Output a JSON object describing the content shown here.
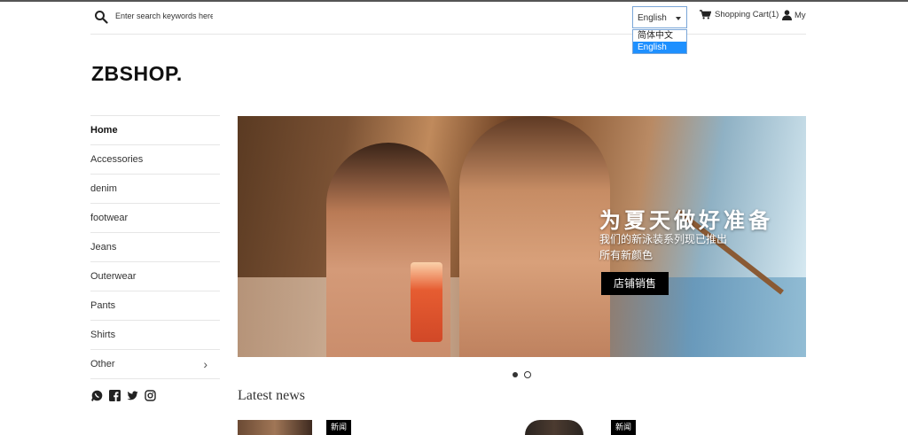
{
  "header": {
    "search_placeholder": "Enter search keywords here",
    "language": {
      "selected": "English",
      "options": [
        "简体中文",
        "English"
      ],
      "highlighted_index": 1
    },
    "cart_label": "Shopping Cart(1)",
    "account_label": "My"
  },
  "logo": "ZBSHOP.",
  "sidebar": {
    "items": [
      {
        "label": "Home"
      },
      {
        "label": "Accessories"
      },
      {
        "label": "denim"
      },
      {
        "label": "footwear"
      },
      {
        "label": "Jeans"
      },
      {
        "label": "Outerwear"
      },
      {
        "label": "Pants"
      },
      {
        "label": "Shirts"
      },
      {
        "label": "Other"
      }
    ],
    "social_icons": [
      "whatsapp-icon",
      "facebook-icon",
      "twitter-icon",
      "instagram-icon"
    ]
  },
  "hero": {
    "title": "为夏天做好准备",
    "subtitle_line1": "我们的新泳装系列现已推出",
    "subtitle_line2": "所有新颜色",
    "button_label": "店铺销售"
  },
  "carousel": {
    "slides": 2,
    "active": 1
  },
  "latest_news": {
    "heading": "Latest news",
    "tags": [
      "新闻",
      "新闻"
    ]
  },
  "colors": {
    "accent": "#1e90ff",
    "button_bg": "#000000",
    "text": "#222222"
  }
}
